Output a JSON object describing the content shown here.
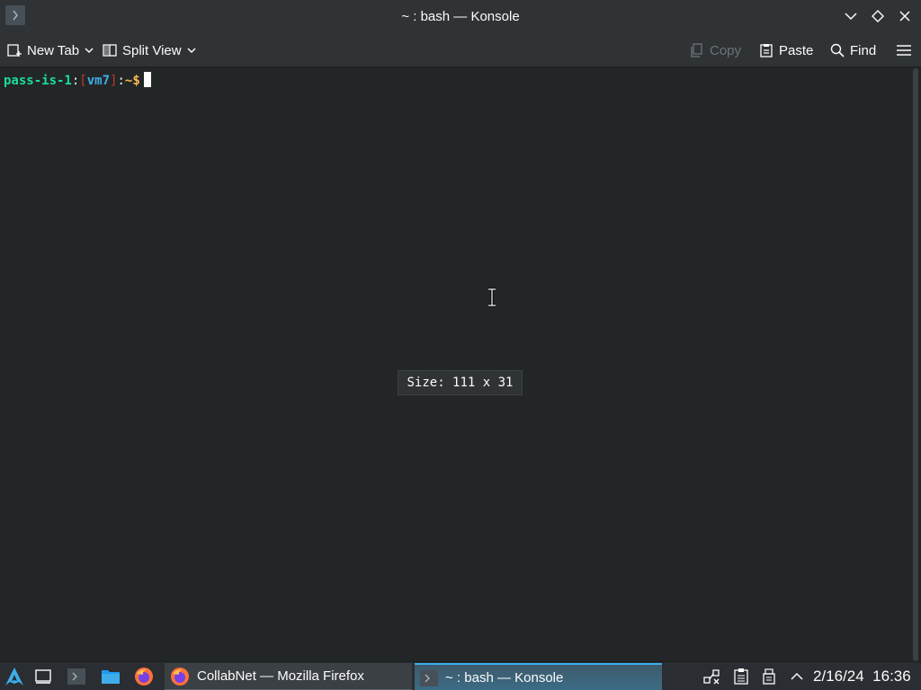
{
  "window": {
    "title": "~ : bash — Konsole"
  },
  "toolbar": {
    "new_tab": "New Tab",
    "split_view": "Split View",
    "copy": "Copy",
    "paste": "Paste",
    "find": "Find"
  },
  "terminal": {
    "host": "pass-is-1",
    "vm": "vm7",
    "path": "~",
    "prompt_symbol": "$",
    "size_tooltip": "Size: 111 x 31"
  },
  "taskbar": {
    "tasks": [
      {
        "label": "CollabNet — Mozilla Firefox",
        "icon": "firefox-icon"
      },
      {
        "label": "~ : bash — Konsole",
        "icon": "konsole-icon",
        "active": true
      }
    ],
    "clock": "2/16/24  16:36"
  },
  "colors": {
    "background": "#232627",
    "accent": "#3daee9",
    "host_green": "#1cdc9a",
    "prompt_yellow": "#fdbc4b",
    "bracket_red": "#c0392b"
  }
}
